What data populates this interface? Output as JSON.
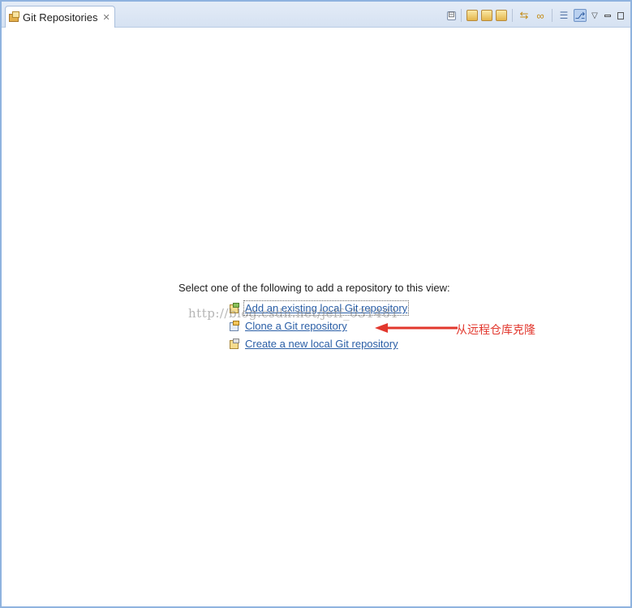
{
  "view": {
    "title": "Git Repositories",
    "close_glyph": "✕"
  },
  "toolbar": {
    "buttons": [
      {
        "icon": "collapse-all-icon",
        "glyph": "⊟"
      },
      {
        "icon": "add-existing-repository-icon",
        "glyph": ""
      },
      {
        "icon": "clone-repository-icon",
        "glyph": ""
      },
      {
        "icon": "create-repository-icon",
        "glyph": ""
      },
      {
        "icon": "link-with-selection-icon",
        "glyph": "⇆"
      },
      {
        "icon": "link-editor-icon",
        "glyph": "∞"
      },
      {
        "icon": "hierarchical-layout-icon",
        "glyph": "☰"
      },
      {
        "icon": "branch-view-icon",
        "glyph": "⎇"
      },
      {
        "icon": "view-menu-icon",
        "glyph": "▽"
      }
    ]
  },
  "main": {
    "prompt": "Select one of the following to add a repository to this view:",
    "links": [
      {
        "label": "Add an existing local Git repository",
        "icon": "add-existing-repository-icon"
      },
      {
        "label": "Clone a Git repository",
        "icon": "clone-repository-icon"
      },
      {
        "label": "Create a new local Git repository",
        "icon": "create-repository-icon"
      }
    ]
  },
  "overlay": {
    "watermark": "http://blog.csdn.net/jeff_031481",
    "annotation": "从远程仓库克隆",
    "annotation_color": "#e2372d"
  }
}
